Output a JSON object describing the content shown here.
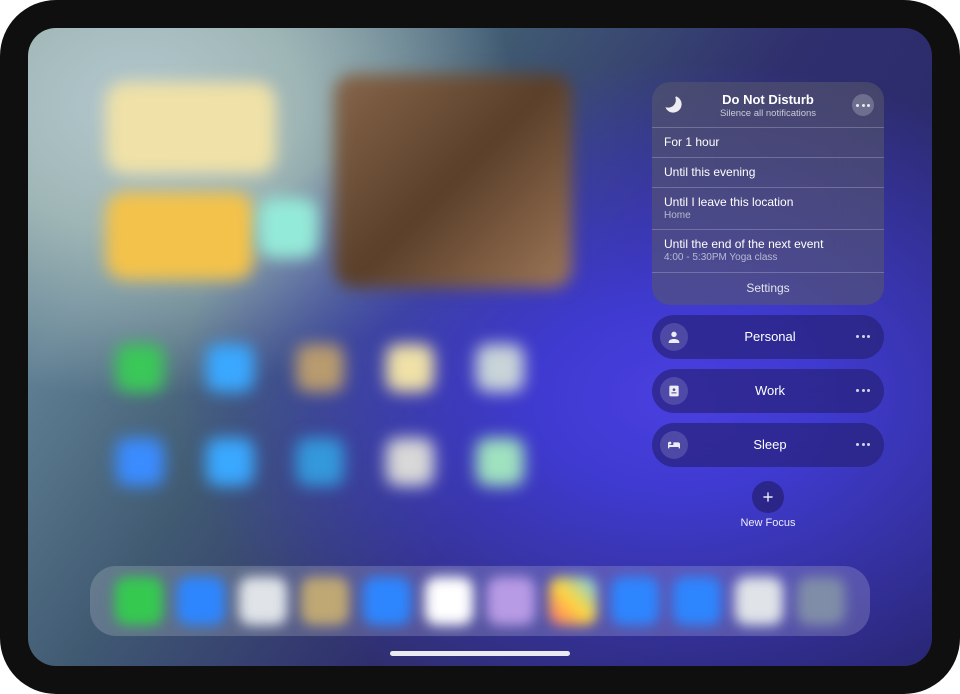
{
  "dnd": {
    "title": "Do Not Disturb",
    "subtitle": "Silence all notifications",
    "options": [
      {
        "label": "For 1 hour",
        "sub": ""
      },
      {
        "label": "Until this evening",
        "sub": ""
      },
      {
        "label": "Until I leave this location",
        "sub": "Home"
      },
      {
        "label": "Until the end of the next event",
        "sub": "4:00 - 5:30PM Yoga class"
      }
    ],
    "settings_label": "Settings"
  },
  "focus_modes": [
    {
      "id": "personal",
      "label": "Personal",
      "icon": "person-icon"
    },
    {
      "id": "work",
      "label": "Work",
      "icon": "badge-icon"
    },
    {
      "id": "sleep",
      "label": "Sleep",
      "icon": "bed-icon"
    }
  ],
  "new_focus": {
    "label": "New Focus"
  }
}
